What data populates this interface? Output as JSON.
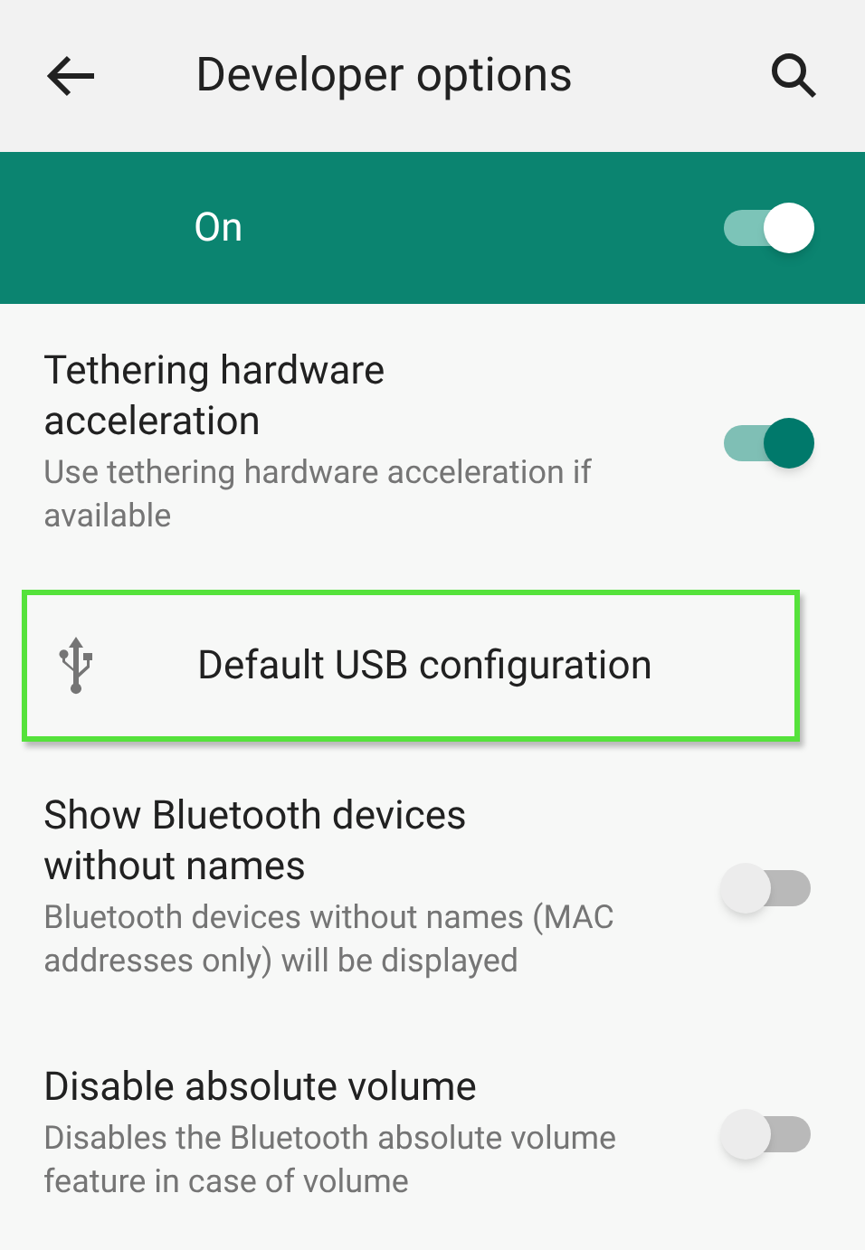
{
  "app_bar": {
    "title": "Developer options"
  },
  "master_switch": {
    "label": "On",
    "on": true
  },
  "items": [
    {
      "kind": "switch",
      "title": "Tethering hardware acceleration",
      "summary": "Use tethering hardware acceleration if available",
      "on": true
    },
    {
      "kind": "link",
      "title": "Default USB configuration",
      "highlighted": true
    },
    {
      "kind": "switch",
      "title": "Show Bluetooth devices without names",
      "summary": "Bluetooth devices without names (MAC addresses only) will be displayed",
      "on": false
    },
    {
      "kind": "switch",
      "title": "Disable absolute volume",
      "summary": "Disables the Bluetooth absolute volume feature in case of volume",
      "on": false
    }
  ]
}
